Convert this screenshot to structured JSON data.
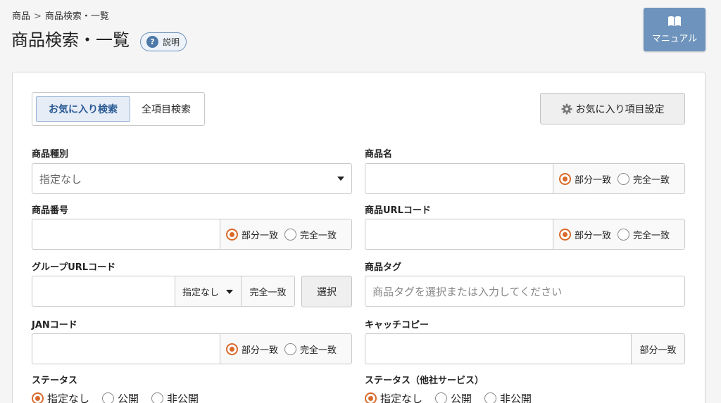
{
  "breadcrumb": {
    "parent": "商品",
    "separator": ">",
    "current": "商品検索・一覧"
  },
  "page": {
    "title": "商品検索・一覧",
    "help_label": "説明",
    "help_glyph": "?"
  },
  "manual_button": {
    "label": "マニュアル",
    "icon": "book-icon"
  },
  "search_tabs": {
    "favorite": "お気に入り検索",
    "all": "全項目検索"
  },
  "favorite_settings": {
    "label": "お気に入り項目設定",
    "icon": "gear-icon"
  },
  "fields": {
    "product_type": {
      "label": "商品種別",
      "value": "指定なし"
    },
    "product_name": {
      "label": "商品名",
      "match": [
        "部分一致",
        "完全一致"
      ],
      "selected": "部分一致"
    },
    "product_number": {
      "label": "商品番号",
      "match": [
        "部分一致",
        "完全一致"
      ],
      "selected": "部分一致"
    },
    "product_url_code": {
      "label": "商品URLコード",
      "match": [
        "部分一致",
        "完全一致"
      ],
      "selected": "部分一致"
    },
    "group_url_code": {
      "label": "グループURLコード",
      "mode": "指定なし",
      "match": "完全一致",
      "select_button": "選択"
    },
    "product_tag": {
      "label": "商品タグ",
      "placeholder": "商品タグを選択または入力してください"
    },
    "jan_code": {
      "label": "JANコード",
      "match": [
        "部分一致",
        "完全一致"
      ],
      "selected": "部分一致"
    },
    "catch_copy": {
      "label": "キャッチコピー",
      "match": "部分一致"
    },
    "status": {
      "label": "ステータス",
      "options": [
        "指定なし",
        "公開",
        "非公開"
      ],
      "selected": "指定なし"
    },
    "status_other": {
      "label": "ステータス（他社サービス）",
      "options": [
        "指定なし",
        "公開",
        "非公開"
      ],
      "selected": "指定なし"
    }
  },
  "colors": {
    "accent": "#d96a2b",
    "primary": "#6e94bd",
    "tab_active": "#2b5a95"
  }
}
